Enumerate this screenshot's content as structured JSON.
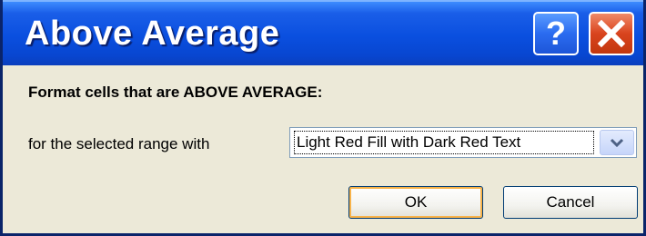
{
  "window": {
    "title": "Above Average",
    "help_icon": "help-question-icon",
    "close_icon": "close-x-icon"
  },
  "content": {
    "heading": "Format cells that are ABOVE AVERAGE:",
    "range_label": "for the selected range with",
    "format_select": {
      "selected_value": "Light Red Fill with Dark Red Text"
    }
  },
  "buttons": {
    "ok_label": "OK",
    "cancel_label": "Cancel"
  },
  "colors": {
    "titlebar": "#0a4fdf",
    "close_button": "#d9441e",
    "dialog_background": "#ece9d8"
  }
}
